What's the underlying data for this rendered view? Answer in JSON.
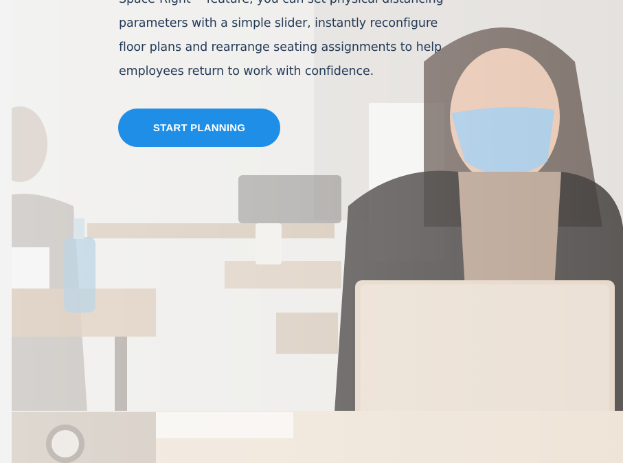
{
  "hero": {
    "lines": [
      "Space-Right™ feature, you can set physical distancing",
      "parameters with a simple slider, instantly reconfigure",
      "floor plans and rearrange seating assignments to help",
      "employees return to work with confidence."
    ],
    "cta_label": "START PLANNING",
    "accent_color": "#1f8ee6",
    "text_color": "#233a56"
  }
}
